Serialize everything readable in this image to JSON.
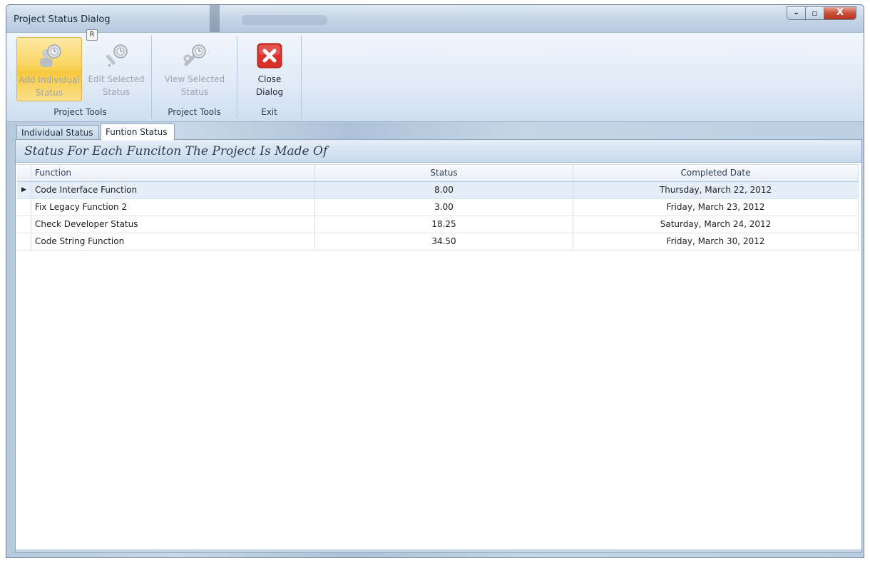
{
  "window": {
    "title": "Project Status Dialog",
    "keytip": "R",
    "controls": {
      "minimize": "–",
      "maximize": "▫",
      "close": "X"
    }
  },
  "ribbon": {
    "groups": [
      {
        "label": "Project Tools",
        "buttons": [
          {
            "label": "Add Individual\nStatus",
            "icon": "add-status-icon",
            "enabled": false,
            "highlighted": true
          },
          {
            "label": "Edit Selected\nStatus",
            "icon": "edit-status-icon",
            "enabled": false,
            "highlighted": false
          }
        ]
      },
      {
        "label": "Project Tools",
        "buttons": [
          {
            "label": "View Selected\nStatus",
            "icon": "view-status-icon",
            "enabled": false,
            "highlighted": false
          }
        ]
      },
      {
        "label": "Exit",
        "buttons": [
          {
            "label": "Close\nDialog",
            "icon": "close-dialog-icon",
            "enabled": true,
            "highlighted": false
          }
        ]
      }
    ]
  },
  "tabs": [
    {
      "label": "Individual Status",
      "selected": false
    },
    {
      "label": "Funtion Status",
      "selected": true
    }
  ],
  "panel": {
    "caption": "Status For Each Funciton The Project Is Made Of"
  },
  "grid": {
    "columns": [
      "Function",
      "Status",
      "Completed Date"
    ],
    "rows": [
      {
        "function": "Code Interface Function",
        "status": "8.00",
        "completed": "Thursday, March 22, 2012",
        "current": true
      },
      {
        "function": "Fix Legacy Function 2",
        "status": "3.00",
        "completed": "Friday, March 23, 2012",
        "current": false
      },
      {
        "function": "Check Developer Status",
        "status": "18.25",
        "completed": "Saturday, March 24, 2012",
        "current": false
      },
      {
        "function": "Code String Function",
        "status": "34.50",
        "completed": "Friday, March 30, 2012",
        "current": false
      }
    ],
    "current_row_marker": "▶"
  },
  "colors": {
    "highlight": "#f9d45e",
    "close_red": "#d9302a",
    "frame": "#8fa4be"
  }
}
